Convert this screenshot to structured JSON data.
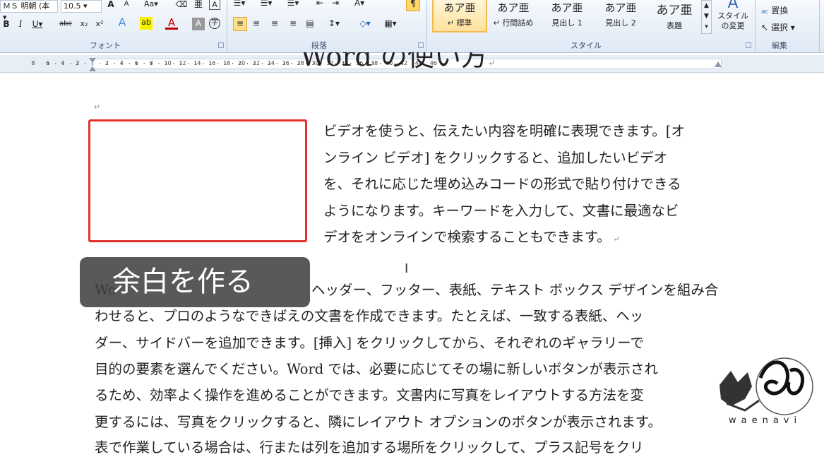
{
  "ribbon": {
    "font_name": "ＭＳ 明朝 (本",
    "font_size": "10.5",
    "groups": {
      "font": "フォント",
      "paragraph": "段落",
      "styles": "スタイル",
      "editing": "編集"
    },
    "styles": [
      {
        "preview": "あア亜",
        "name": "標準"
      },
      {
        "preview": "あア亜",
        "name": "行間詰め"
      },
      {
        "preview": "あア亜",
        "name": "見出し 1"
      },
      {
        "preview": "あア亜",
        "name": "見出し 2"
      },
      {
        "preview": "あア亜",
        "name": "表題"
      }
    ],
    "change_style": "スタイルの変更",
    "replace": "置換",
    "select": "選択"
  },
  "ruler": {
    "numbers": [
      "8",
      "6",
      "4",
      "2",
      "2",
      "4",
      "6",
      "8",
      "10",
      "12",
      "14",
      "16",
      "18",
      "20",
      "22",
      "24",
      "26",
      "28",
      "30",
      "32",
      "34",
      "36",
      "38",
      "40",
      "42",
      "44",
      "46"
    ]
  },
  "document": {
    "title": "Word の使い方",
    "right_paragraph": [
      "ビデオを使うと、伝えたい内容を明確に表現できます。[オ",
      "ンライン ビデオ] をクリックすると、追加したいビデオ",
      "を、それに応じた埋め込みコードの形式で貼り付けできる",
      "ようになります。キーワードを入力して、文書に最適なビ",
      "デオをオンラインで検索することもできます。"
    ],
    "body_first_line_tail": "ヘッダー、フッター、表紙、テキスト ボックス デザインを組み合",
    "body_first_line_head": "Wo",
    "body": [
      "わせると、プロのようなできばえの文書を作成できます。たとえば、一致する表紙、ヘッ",
      "ダー、サイドバーを追加できます。[挿入] をクリックしてから、それぞれのギャラリーで",
      "目的の要素を選んでください。Word では、必要に応じてその場に新しいボタンが表示され",
      "るため、効率よく操作を進めることができます。文書内に写真をレイアウトする方法を変",
      "更するには、写真をクリックすると、隣にレイアウト オプションのボタンが表示されます。",
      "表で作業している場合は、行または列を追加する場所をクリックして、プラス記号をクリ"
    ]
  },
  "caption": "余白を作る",
  "logo_text": "waenavi"
}
